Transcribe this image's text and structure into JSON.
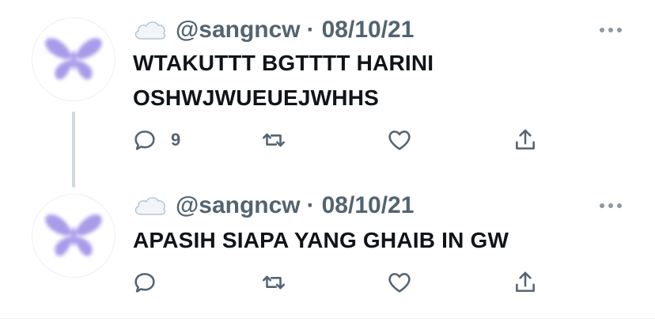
{
  "tweets": [
    {
      "handle": "@sangncw",
      "separator": "·",
      "date": "08/10/21",
      "text_lines": [
        "WTAKUTTT BGTTTT HARINI",
        "OSHWJWUEUEJWHHS"
      ],
      "reply_count": "9",
      "retweet_count": "",
      "like_count": ""
    },
    {
      "handle": "@sangncw",
      "separator": "·",
      "date": "08/10/21",
      "text_lines": [
        "APASIH SIAPA YANG GHAIB IN GW"
      ],
      "reply_count": "",
      "retweet_count": "",
      "like_count": ""
    }
  ],
  "icons": {
    "avatar": "purple-butterfly",
    "name_emoji": "cloud-icon",
    "more": "more-icon",
    "reply": "reply-icon",
    "retweet": "retweet-icon",
    "like": "like-icon",
    "share": "share-icon"
  },
  "colors": {
    "text": "#0f1419",
    "secondary": "#536471",
    "thread_line": "#cfd9de",
    "avatar_butterfly": "#9b8ae6"
  }
}
